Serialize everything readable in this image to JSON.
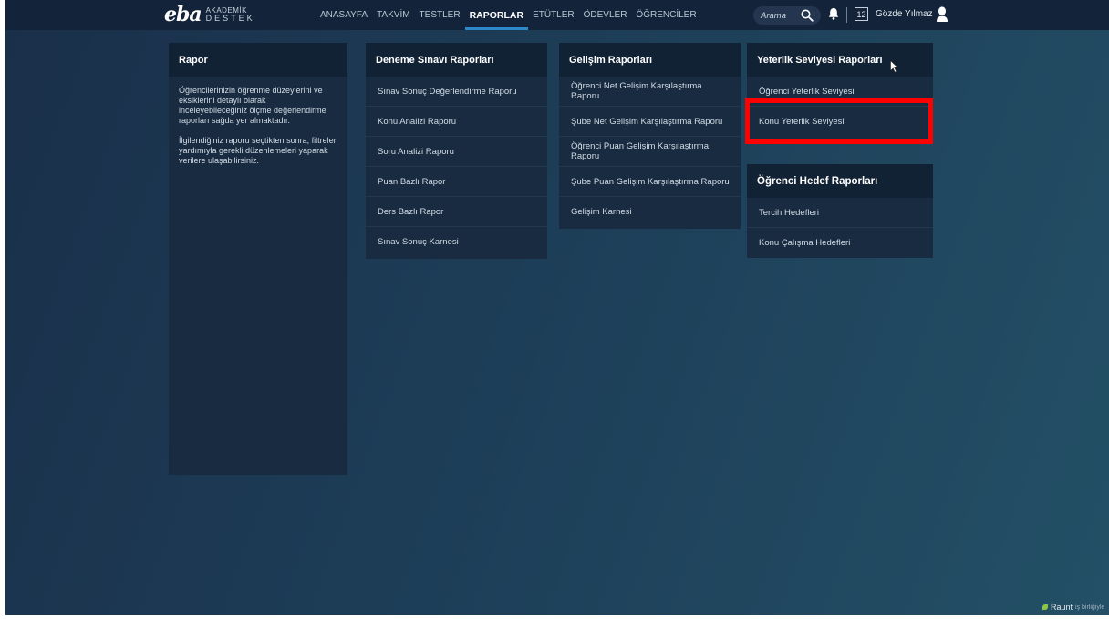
{
  "logo": {
    "mark": "eba",
    "line1": "AKADEMİK",
    "line2": "DESTEK"
  },
  "nav": [
    {
      "label": "ANASAYFA"
    },
    {
      "label": "TAKVİM"
    },
    {
      "label": "TESTLER"
    },
    {
      "label": "RAPORLAR",
      "active": true
    },
    {
      "label": "ETÜTLER"
    },
    {
      "label": "ÖDEVLER"
    },
    {
      "label": "ÖĞRENCİLER"
    }
  ],
  "search": {
    "placeholder": "Arama"
  },
  "calendar_day": "12",
  "user": {
    "name": "Gözde Yılmaz"
  },
  "intro": {
    "title": "Rapor",
    "paragraph1": "Öğrencilerinizin öğrenme düzeylerini ve eksiklerini detaylı olarak inceleyebileceğiniz ölçme değerlendirme raporları sağda yer almaktadır.",
    "paragraph2": "İlgilendiğiniz raporu seçtikten sonra, filtreler yardımıyla gerekli düzenlemeleri yaparak verilere ulaşabilirsiniz."
  },
  "deneme": {
    "title": "Deneme Sınavı Raporları",
    "items": [
      "Sınav Sonuç Değerlendirme Raporu",
      "Konu Analizi Raporu",
      "Soru Analizi Raporu",
      "Puan Bazlı Rapor",
      "Ders Bazlı Rapor",
      "Sınav Sonuç Karnesi"
    ]
  },
  "gelisim": {
    "title": "Gelişim Raporları",
    "items": [
      "Öğrenci Net Gelişim Karşılaştırma Raporu",
      "Şube Net Gelişim Karşılaştırma Raporu",
      "Öğrenci Puan Gelişim Karşılaştırma Raporu",
      "Şube Puan Gelişim Karşılaştırma Raporu",
      "Gelişim Karnesi"
    ]
  },
  "yeterlik": {
    "title": "Yeterlik Seviyesi Raporları",
    "items": [
      "Öğrenci Yeterlik Seviyesi",
      "Konu Yeterlik Seviyesi"
    ]
  },
  "hedef": {
    "title": "Öğrenci Hedef Raporları",
    "items": [
      "Tercih Hedefleri",
      "Konu Çalışma Hedefleri"
    ]
  },
  "watermark": {
    "brand": "Raunt",
    "tail": "iş birliğiyle"
  },
  "colors": {
    "highlight": "#ff0000",
    "nav_active_underline": "#2d88c8"
  }
}
